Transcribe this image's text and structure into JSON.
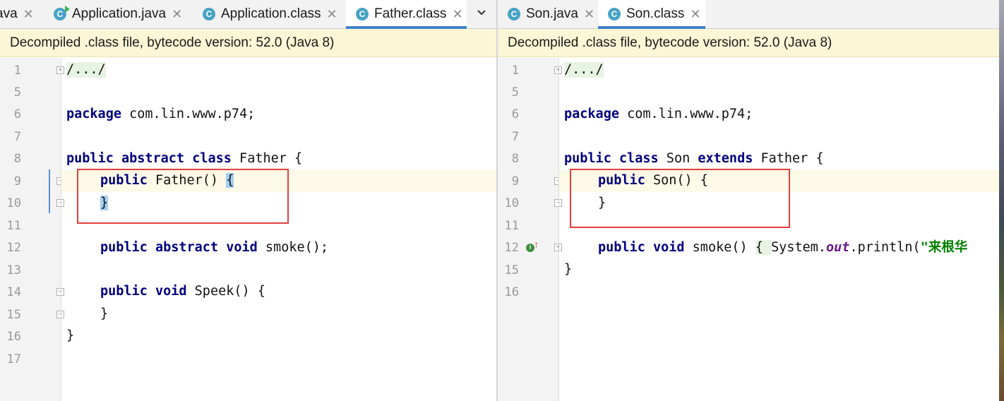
{
  "left": {
    "tabs": [
      {
        "label": "ava",
        "icon": "none"
      },
      {
        "label": "Application.java",
        "icon": "java-class-run-icon"
      },
      {
        "label": "Application.class",
        "icon": "class-icon"
      },
      {
        "label": "Father.class",
        "icon": "class-icon",
        "active": true
      }
    ],
    "banner": "Decompiled .class file, bytecode version: 52.0 (Java 8)",
    "line_numbers": [
      "1",
      "5",
      "6",
      "7",
      "8",
      "9",
      "10",
      "11",
      "12",
      "13",
      "14",
      "15",
      "16",
      "17"
    ],
    "code": {
      "l1": "/.../",
      "l6_kw": "package",
      "l6_rest": " com.lin.www.p74;",
      "l8_kw1": "public",
      "l8_kw2": "abstract",
      "l8_kw3": "class",
      "l8_rest": " Father {",
      "l9_kw": "public",
      "l9_rest": " Father() ",
      "l9_brace": "{",
      "l10_brace": "}",
      "l12_kw1": "public",
      "l12_kw2": "abstract",
      "l12_kw3": "void",
      "l12_rest": " smoke();",
      "l14_kw1": "public",
      "l14_kw2": "void",
      "l14_rest": " Speek() {",
      "l15": "}",
      "l16": "}"
    }
  },
  "right": {
    "tabs": [
      {
        "label": "Son.java",
        "icon": "class-icon"
      },
      {
        "label": "Son.class",
        "icon": "class-icon",
        "active": true
      }
    ],
    "banner": "Decompiled .class file, bytecode version: 52.0 (Java 8)",
    "line_numbers": [
      "1",
      "5",
      "6",
      "7",
      "8",
      "9",
      "10",
      "11",
      "12",
      "15",
      "16"
    ],
    "code": {
      "l1": "/.../",
      "l6_kw": "package",
      "l6_rest": " com.lin.www.p74;",
      "l8_kw1": "public",
      "l8_kw2": "class",
      "l8_mid": " Son ",
      "l8_kw3": "extends",
      "l8_rest": " Father {",
      "l9_kw": "public",
      "l9_rest": " Son() {",
      "l10": "}",
      "l12_kw1": "public",
      "l12_kw2": "void",
      "l12_a": " smoke() ",
      "l12_b": "{ ",
      "l12_c": "System.",
      "l12_out": "out",
      "l12_d": ".println(",
      "l12_str": "\"来根华",
      "l15": "}"
    }
  },
  "colors": {
    "keyword": "#000080",
    "banner_bg": "#fbf6d6",
    "highlight_box": "#e0403c",
    "active_tab_underline": "#4083c9"
  }
}
